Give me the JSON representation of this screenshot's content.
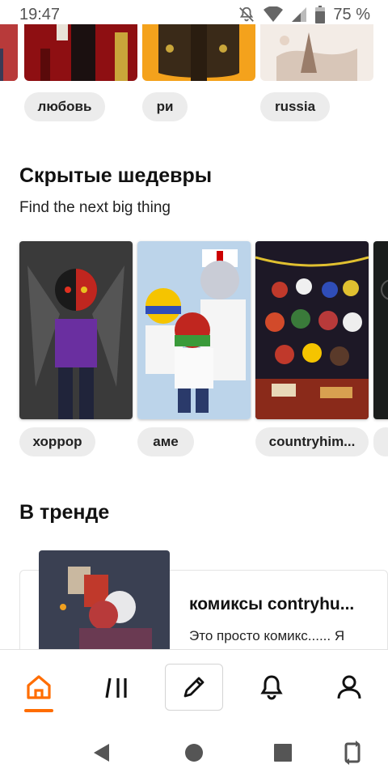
{
  "status_bar": {
    "time": "19:47",
    "battery": "75 %",
    "icons": [
      "mute-icon",
      "wifi-icon",
      "signal-icon",
      "battery-icon"
    ]
  },
  "top_tags": [
    "любовь",
    "ри",
    "russia"
  ],
  "hidden_gems": {
    "title": "Скрытые шедевры",
    "subtitle": "Find the next big thing",
    "tags": [
      "хоррор",
      "аме",
      "countryhim..."
    ]
  },
  "trending": {
    "title": "В тренде",
    "item": {
      "title": "комиксы contryhu...",
      "description": "Это просто комикс...... Я"
    }
  },
  "bottom_nav": {
    "items": [
      "home-icon",
      "library-icon",
      "write-icon",
      "notifications-icon",
      "profile-icon"
    ],
    "active": "home",
    "accent_color": "#ff6d00"
  },
  "system_nav": [
    "back-icon",
    "home-circle-icon",
    "recents-icon",
    "rotate-icon"
  ]
}
